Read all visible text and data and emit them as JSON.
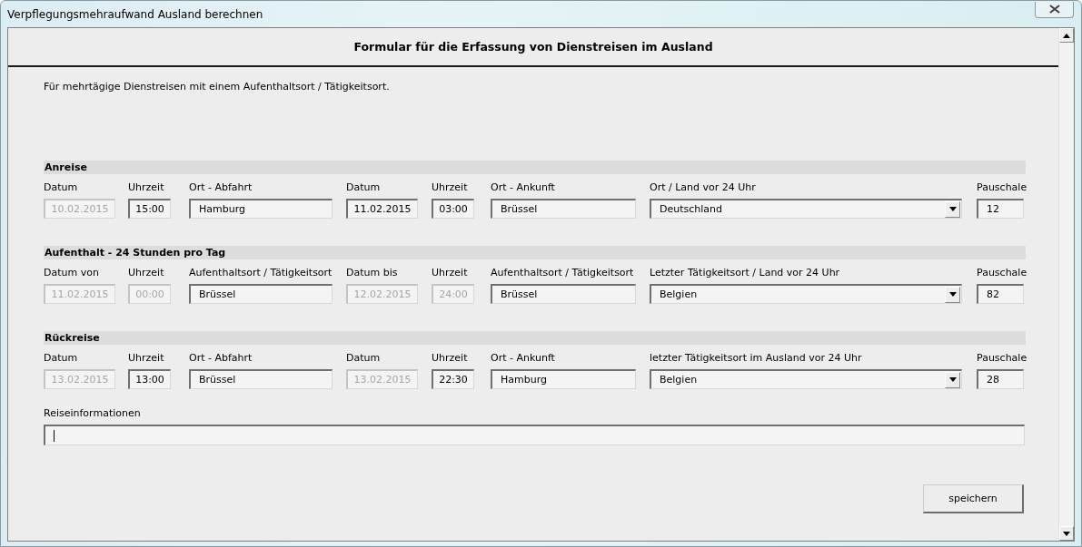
{
  "window": {
    "title": "Verpflegungsmehraufwand Ausland berechnen"
  },
  "form": {
    "heading": "Formular für die Erfassung von Dienstreisen im Ausland",
    "intro": "Für mehrtägige Dienstreisen mit einem Aufenthaltsort / Tätigkeitsort.",
    "sections": [
      {
        "title": "Anreise",
        "fields": [
          {
            "kind": "date",
            "label": "Datum",
            "value": "10.02.2015",
            "disabled": true
          },
          {
            "kind": "time",
            "label": "Uhrzeit",
            "value": "15:00",
            "disabled": false
          },
          {
            "kind": "text",
            "label": "Ort - Abfahrt",
            "value": "Hamburg",
            "disabled": false
          },
          {
            "kind": "date",
            "label": "Datum",
            "value": "11.02.2015",
            "disabled": false
          },
          {
            "kind": "time",
            "label": "Uhrzeit",
            "value": "03:00",
            "disabled": false
          },
          {
            "kind": "text",
            "label": "Ort - Ankunft",
            "value": "Brüssel",
            "disabled": false
          },
          {
            "kind": "dropdown",
            "label": "Ort / Land vor 24 Uhr",
            "value": "Deutschland",
            "disabled": false
          },
          {
            "kind": "number",
            "label": "Pauschale",
            "value": "12",
            "disabled": false
          }
        ]
      },
      {
        "title": "Aufenthalt - 24 Stunden pro Tag",
        "fields": [
          {
            "kind": "date",
            "label": "Datum von",
            "value": "11.02.2015",
            "disabled": true
          },
          {
            "kind": "time",
            "label": "Uhrzeit",
            "value": "00:00",
            "disabled": true
          },
          {
            "kind": "text",
            "label": "Aufenthaltsort / Tätigkeitsort",
            "value": "Brüssel",
            "disabled": false
          },
          {
            "kind": "date",
            "label": "Datum bis",
            "value": "12.02.2015",
            "disabled": true
          },
          {
            "kind": "time",
            "label": "Uhrzeit",
            "value": "24:00",
            "disabled": true
          },
          {
            "kind": "text",
            "label": "Aufenthaltsort / Tätigkeitsort",
            "value": "Brüssel",
            "disabled": false
          },
          {
            "kind": "dropdown",
            "label": "Letzter Tätigkeitsort / Land vor 24 Uhr",
            "value": "Belgien",
            "disabled": false
          },
          {
            "kind": "number",
            "label": "Pauschale",
            "value": "82",
            "disabled": false
          }
        ]
      },
      {
        "title": "Rückreise",
        "fields": [
          {
            "kind": "date",
            "label": "Datum",
            "value": "13.02.2015",
            "disabled": true
          },
          {
            "kind": "time",
            "label": "Uhrzeit",
            "value": "13:00",
            "disabled": false
          },
          {
            "kind": "text",
            "label": "Ort - Abfahrt",
            "value": "Brüssel",
            "disabled": false
          },
          {
            "kind": "date",
            "label": "Datum",
            "value": "13.02.2015",
            "disabled": true
          },
          {
            "kind": "time",
            "label": "Uhrzeit",
            "value": "22:30",
            "disabled": false
          },
          {
            "kind": "text",
            "label": "Ort - Ankunft",
            "value": "Hamburg",
            "disabled": false
          },
          {
            "kind": "dropdown",
            "label": "letzter Tätigkeitsort im Ausland vor 24 Uhr",
            "value": "Belgien",
            "disabled": false
          },
          {
            "kind": "number",
            "label": "Pauschale",
            "value": "28",
            "disabled": false
          }
        ]
      }
    ],
    "notes": {
      "label": "Reiseinformationen",
      "focused": true
    },
    "save_button": "speichern"
  }
}
